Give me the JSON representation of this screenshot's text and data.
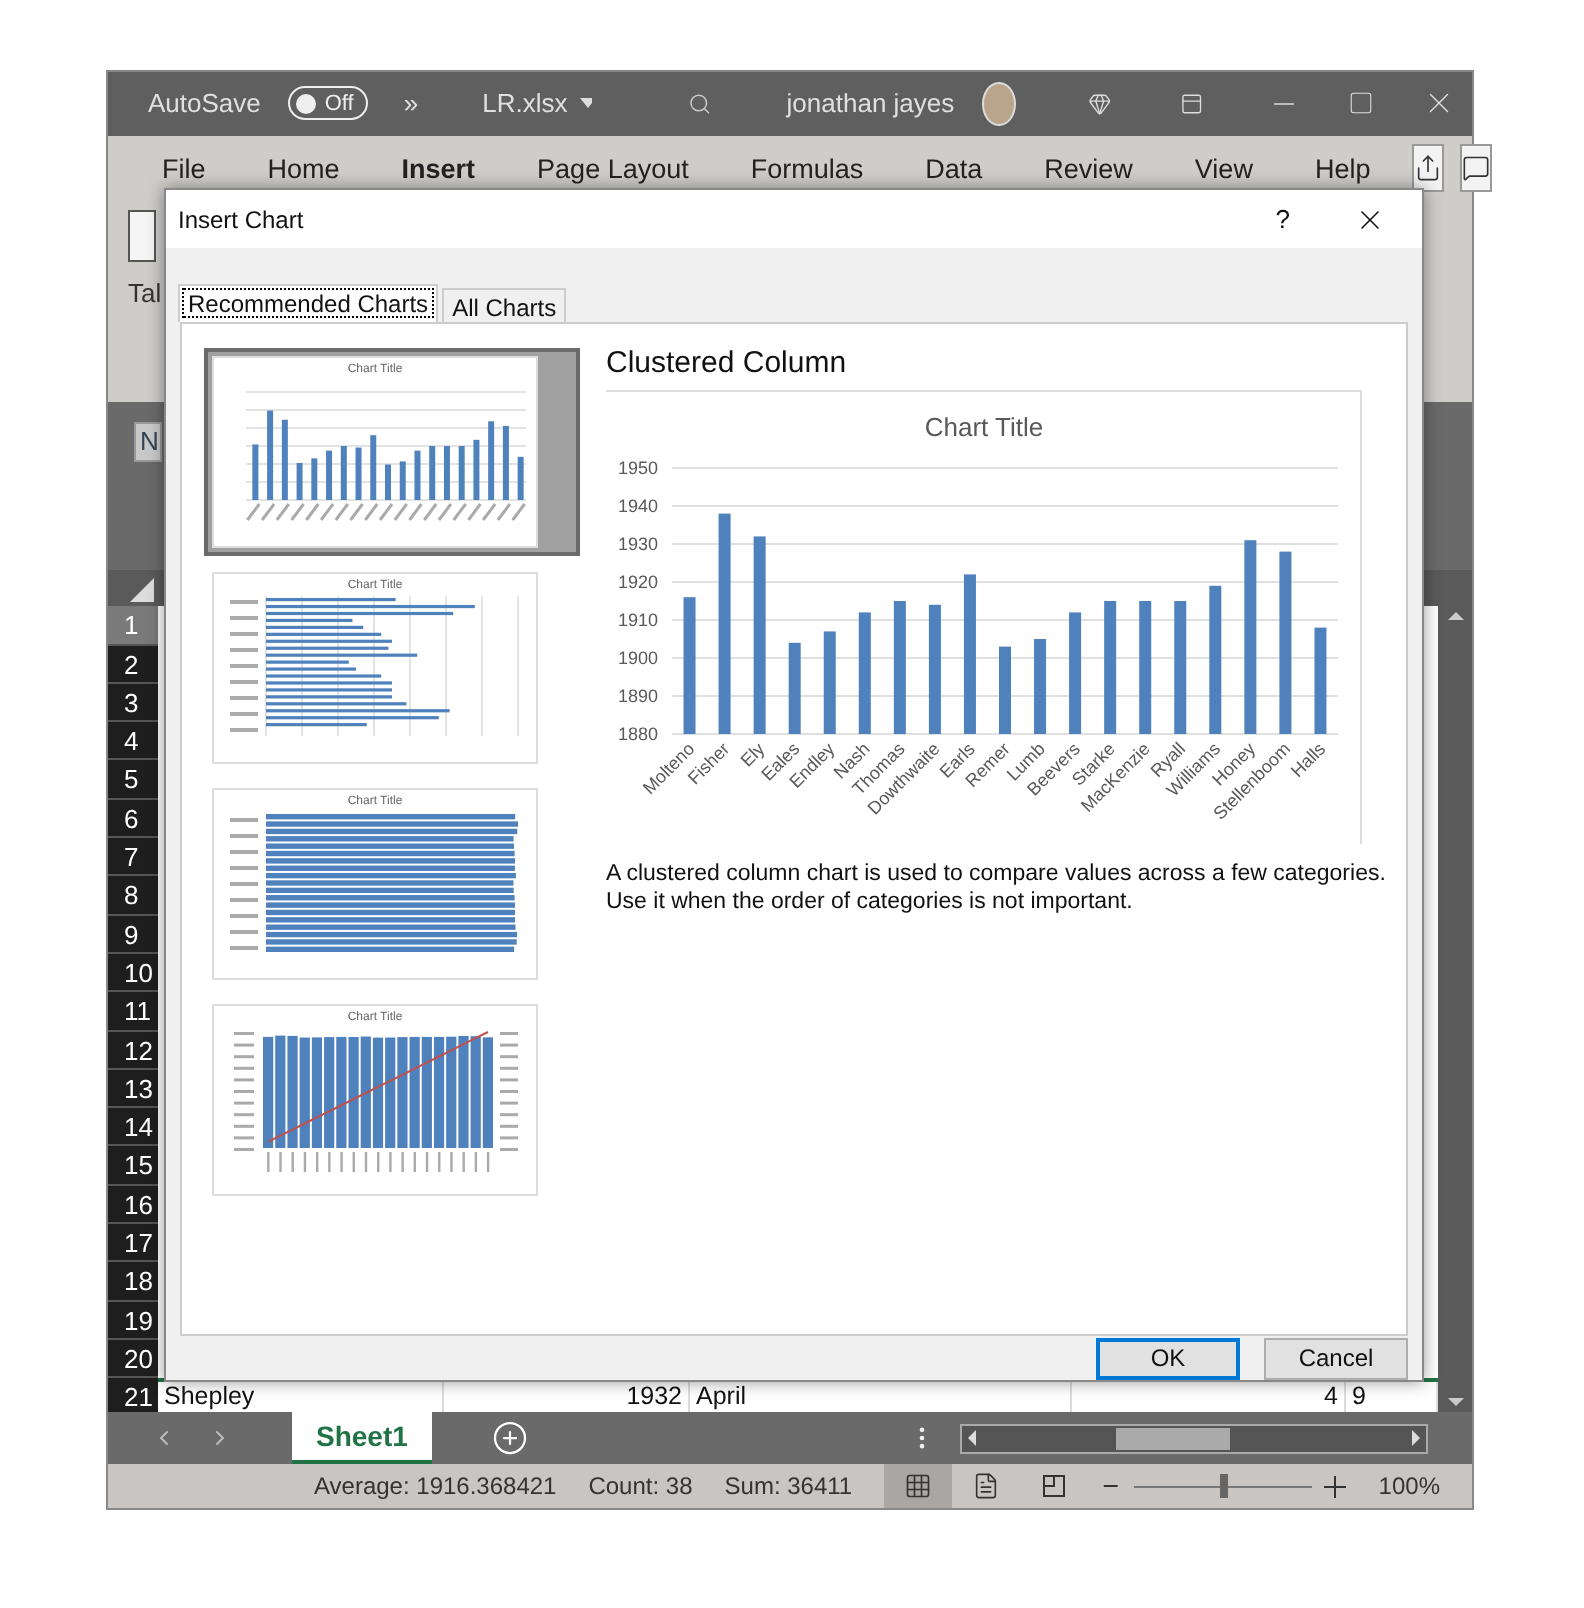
{
  "titlebar": {
    "autosave_label": "AutoSave",
    "autosave": {
      "on": false,
      "label": "Off"
    },
    "more": "»",
    "filename": "LR.xlsx",
    "user": "jonathan jayes"
  },
  "ribbon_tabs": [
    {
      "label": "File",
      "selected": false
    },
    {
      "label": "Home",
      "selected": false
    },
    {
      "label": "Insert",
      "selected": true
    },
    {
      "label": "Page Layout",
      "selected": false
    },
    {
      "label": "Formulas",
      "selected": false
    },
    {
      "label": "Data",
      "selected": false
    },
    {
      "label": "Review",
      "selected": false
    },
    {
      "label": "View",
      "selected": false
    },
    {
      "label": "Help",
      "selected": false
    }
  ],
  "ribbon": {
    "partial_label": "Tal"
  },
  "name_box": "N",
  "row_headers": [
    {
      "label": "1",
      "selected": true
    },
    {
      "label": "2",
      "selected": false
    },
    {
      "label": "3",
      "selected": false
    },
    {
      "label": "4",
      "selected": false
    },
    {
      "label": "5",
      "selected": false
    },
    {
      "label": "6",
      "selected": false
    },
    {
      "label": "7",
      "selected": false
    },
    {
      "label": "8",
      "selected": false
    },
    {
      "label": "9",
      "selected": false
    },
    {
      "label": "10",
      "selected": false
    },
    {
      "label": "11",
      "selected": false
    },
    {
      "label": "12",
      "selected": false
    },
    {
      "label": "13",
      "selected": false
    },
    {
      "label": "14",
      "selected": false
    },
    {
      "label": "15",
      "selected": false
    },
    {
      "label": "16",
      "selected": false
    },
    {
      "label": "17",
      "selected": false
    },
    {
      "label": "18",
      "selected": false
    },
    {
      "label": "19",
      "selected": false
    },
    {
      "label": "20",
      "selected": false
    },
    {
      "label": "21",
      "selected": false
    }
  ],
  "visible_row": {
    "cells": [
      "Shepley",
      "1932",
      "April",
      "4",
      "9"
    ]
  },
  "sheet_tabs": [
    {
      "label": "Sheet1",
      "selected": true
    }
  ],
  "status_bar": {
    "average": "Average: 1916.368421",
    "count": "Count: 38",
    "sum": "Sum: 36411",
    "zoom": {
      "level": 0.5,
      "label": "100%"
    }
  },
  "dialog": {
    "title": "Insert Chart",
    "help": "?",
    "tabs": [
      {
        "label": "Recommended Charts",
        "selected": true
      },
      {
        "label": "All Charts",
        "selected": false
      }
    ],
    "thumbnails": [
      {
        "kind": "column",
        "title": "Chart Title",
        "selected": true
      },
      {
        "kind": "bar",
        "title": "Chart Title",
        "selected": false
      },
      {
        "kind": "stacked",
        "title": "Chart Title",
        "selected": false
      },
      {
        "kind": "pareto",
        "title": "Chart Title",
        "selected": false
      }
    ],
    "chart_name": "Clustered Column",
    "chart_data": {
      "type": "bar",
      "title": "Chart Title",
      "categories": [
        "Molteno",
        "Fisher",
        "Ely",
        "Eales",
        "Endley",
        "Nash",
        "Thomas",
        "Dowthwaite",
        "Earls",
        "Remer",
        "Lumb",
        "Beevers",
        "Starke",
        "MacKenzie",
        "Ryall",
        "Williams",
        "Honey",
        "Stellenboom",
        "Halls"
      ],
      "grid": true,
      "series": [
        {
          "color": "#4f81bd",
          "values": [
            1916,
            1938,
            1932,
            1904,
            1907,
            1912,
            1915,
            1914,
            1922,
            1903,
            1905,
            1912,
            1915,
            1915,
            1915,
            1919,
            1931,
            1928,
            1908
          ]
        }
      ],
      "ylim": [
        1880,
        1950
      ],
      "yticks": [
        1880,
        1890,
        1900,
        1910,
        1920,
        1930,
        1940,
        1950
      ]
    },
    "description": "A clustered column chart is used to compare values across a few categories.\nUse it when the order of categories is not important.",
    "buttons": [
      {
        "label": "OK",
        "focused": true
      },
      {
        "label": "Cancel",
        "focused": false
      }
    ]
  }
}
